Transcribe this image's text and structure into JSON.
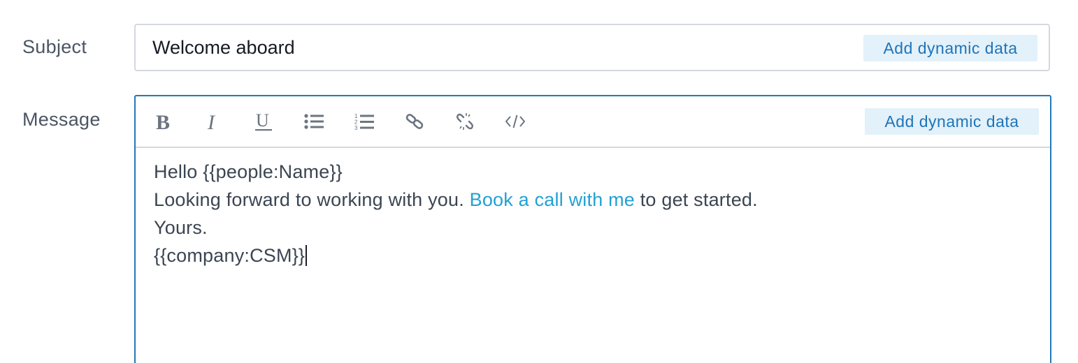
{
  "subject": {
    "label": "Subject",
    "value": "Welcome aboard",
    "dynamic_button": "Add dynamic data"
  },
  "message": {
    "label": "Message",
    "dynamic_button": "Add dynamic data",
    "toolbar": [
      {
        "name": "bold",
        "icon": "bold-icon"
      },
      {
        "name": "italic",
        "icon": "italic-icon"
      },
      {
        "name": "underline",
        "icon": "underline-icon"
      },
      {
        "name": "bulleted-list",
        "icon": "bulleted-list-icon"
      },
      {
        "name": "numbered-list",
        "icon": "numbered-list-icon"
      },
      {
        "name": "link",
        "icon": "link-icon"
      },
      {
        "name": "unlink",
        "icon": "unlink-icon"
      },
      {
        "name": "code",
        "icon": "code-icon"
      }
    ],
    "body": {
      "line1": "Hello {{people:Name}}",
      "line2_before": "Looking forward to working with you. ",
      "line2_link": "Book a call with me",
      "line2_after": " to get started.",
      "line3": "Yours.",
      "line4": "{{company:CSM}}"
    }
  },
  "colors": {
    "accent": "#2278b8",
    "link": "#22a1d4",
    "button_bg": "#e2f1fa",
    "text": "#3b4552",
    "icon": "#6b7480"
  }
}
